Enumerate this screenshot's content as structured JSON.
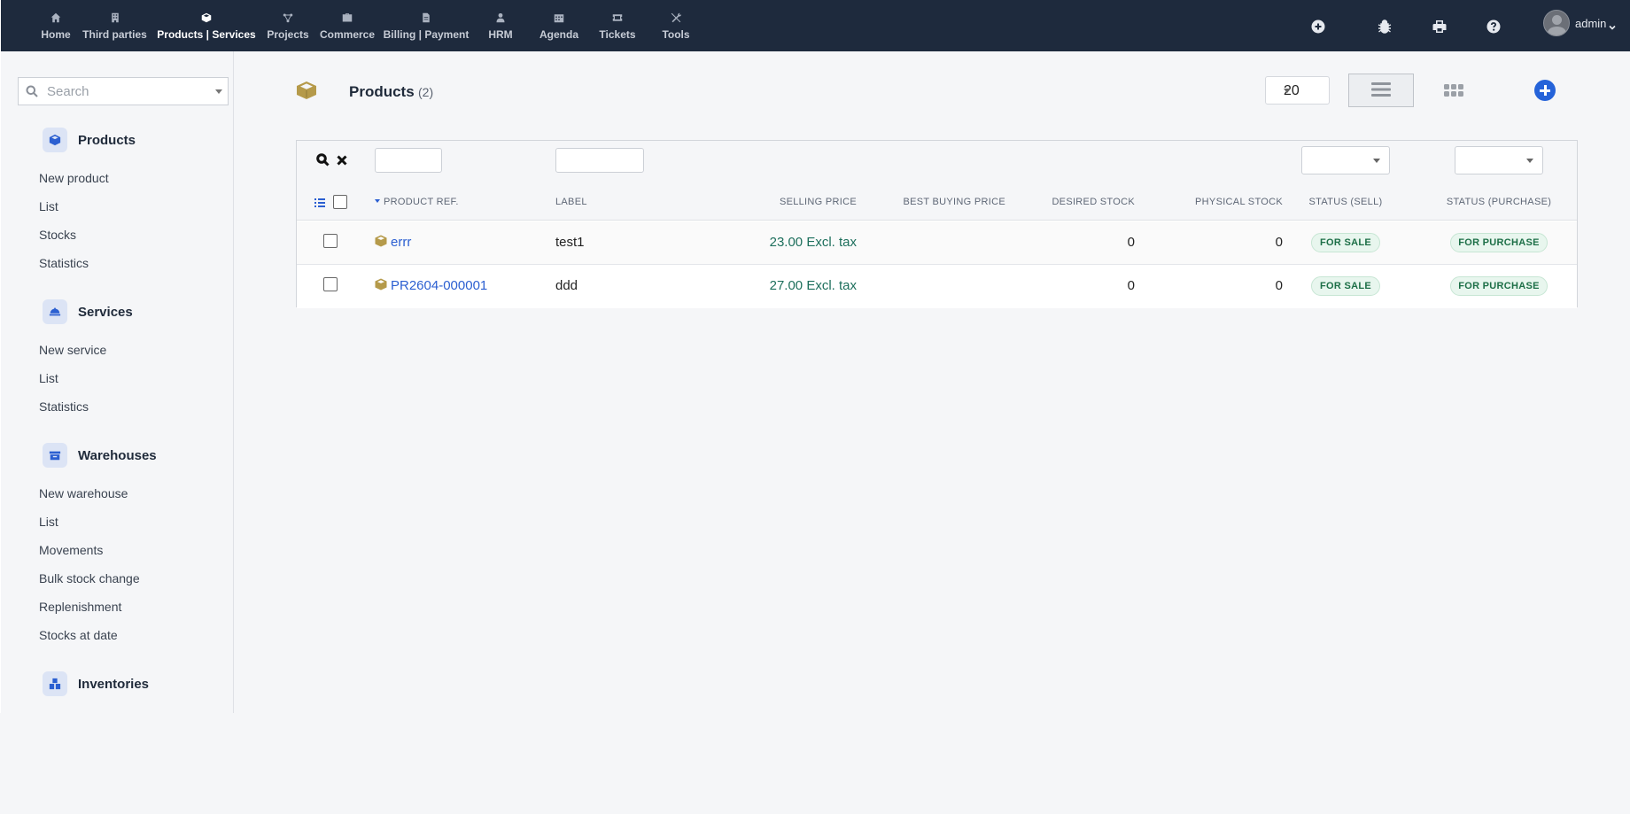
{
  "topbar": {
    "menu": [
      {
        "label": "Home",
        "icon": "home-icon",
        "active": false
      },
      {
        "label": "Third parties",
        "icon": "building-icon",
        "active": false
      },
      {
        "label": "Products | Services",
        "icon": "cube-icon",
        "active": true
      },
      {
        "label": "Projects",
        "icon": "project-icon",
        "active": false
      },
      {
        "label": "Commerce",
        "icon": "suitcase-icon",
        "active": false
      },
      {
        "label": "Billing | Payment",
        "icon": "invoice-icon",
        "active": false
      },
      {
        "label": "HRM",
        "icon": "user-tie-icon",
        "active": false
      },
      {
        "label": "Agenda",
        "icon": "calendar-icon",
        "active": false
      },
      {
        "label": "Tickets",
        "icon": "ticket-icon",
        "active": false
      },
      {
        "label": "Tools",
        "icon": "tools-icon",
        "active": false
      }
    ],
    "user": {
      "name": "admin"
    }
  },
  "sidebar": {
    "search_placeholder": "Search",
    "sections": [
      {
        "title": "Products",
        "icon": "cube-icon",
        "links": [
          "New product",
          "List",
          "Stocks",
          "Statistics"
        ]
      },
      {
        "title": "Services",
        "icon": "concierge-bell-icon",
        "links": [
          "New service",
          "List",
          "Statistics"
        ]
      },
      {
        "title": "Warehouses",
        "icon": "warehouse-icon",
        "links": [
          "New warehouse",
          "List",
          "Movements",
          "Bulk stock change",
          "Replenishment",
          "Stocks at date"
        ]
      },
      {
        "title": "Inventories",
        "icon": "boxes-icon",
        "links": []
      }
    ]
  },
  "page": {
    "title": "Products",
    "count": "(2)",
    "limit": "20"
  },
  "table": {
    "columns": {
      "ref": "PRODUCT REF.",
      "label": "LABEL",
      "selling_price": "SELLING PRICE",
      "best_buying_price": "BEST BUYING PRICE",
      "desired_stock": "DESIRED STOCK",
      "physical_stock": "PHYSICAL STOCK",
      "status_sell": "STATUS (SELL)",
      "status_purchase": "STATUS (PURCHASE)"
    },
    "rows": [
      {
        "ref": "errr",
        "label": "test1",
        "selling_price": "23.00 Excl. tax",
        "best_buying_price": "",
        "desired_stock": "0",
        "physical_stock": "0",
        "status_sell": "FOR SALE",
        "status_purchase": "FOR PURCHASE"
      },
      {
        "ref": "PR2604-000001",
        "label": "ddd",
        "selling_price": "27.00 Excl. tax",
        "best_buying_price": "",
        "desired_stock": "0",
        "physical_stock": "0",
        "status_sell": "FOR SALE",
        "status_purchase": "FOR PURCHASE"
      }
    ]
  },
  "colors": {
    "topbar_bg": "#1e2a3d",
    "accent": "#2563d9",
    "product_icon": "#b59a4a",
    "badge_text": "#1d6f47"
  }
}
